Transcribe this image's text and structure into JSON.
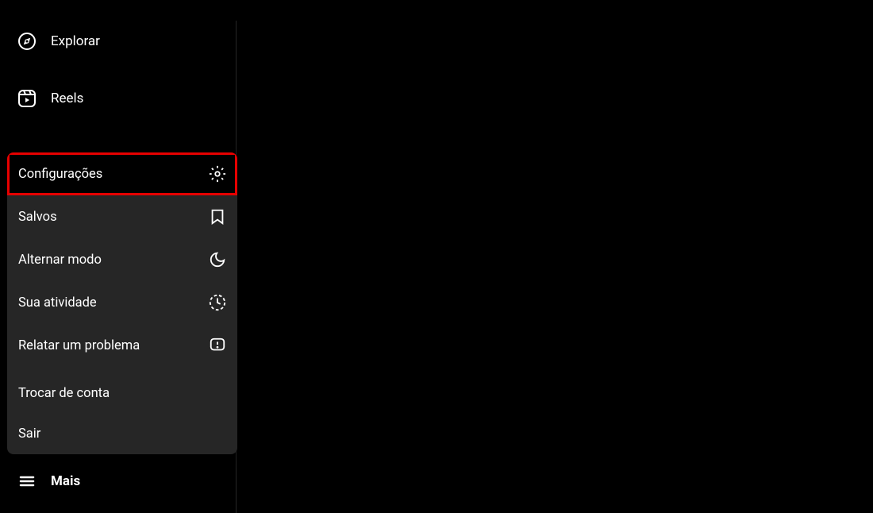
{
  "sidebar": {
    "explorar": "Explorar",
    "reels": "Reels",
    "more": "Mais"
  },
  "popup": {
    "configuracoes": "Configurações",
    "salvos": "Salvos",
    "alternar_modo": "Alternar modo",
    "sua_atividade": "Sua atividade",
    "relatar_problema": "Relatar um problema",
    "trocar_conta": "Trocar de conta",
    "sair": "Sair"
  }
}
